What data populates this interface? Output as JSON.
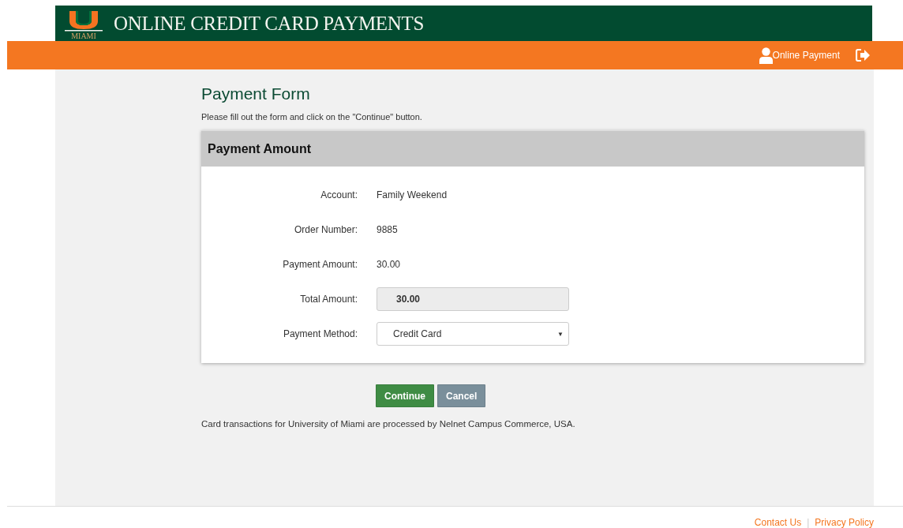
{
  "header": {
    "logo_text": "MIAMI",
    "title": "ONLINE CREDIT CARD PAYMENTS"
  },
  "nav": {
    "user_label": "Online Payment"
  },
  "page": {
    "title": "Payment Form",
    "instructions": "Please fill out the form and click on the \"Continue\" button."
  },
  "panel": {
    "title": "Payment Amount",
    "rows": [
      {
        "kind": "text",
        "label": "Account:",
        "value": "Family Weekend"
      },
      {
        "kind": "text",
        "label": "Order Number:",
        "value": "9885"
      },
      {
        "kind": "text",
        "label": "Payment Amount:",
        "value": "30.00"
      },
      {
        "kind": "readonly",
        "label": "Total Amount:",
        "value": "30.00"
      },
      {
        "kind": "select",
        "label": "Payment Method:",
        "value": "Credit Card",
        "caret": "▼"
      }
    ]
  },
  "buttons": [
    {
      "kind": "primary",
      "label": "Continue"
    },
    {
      "kind": "secondary",
      "label": "Cancel"
    }
  ],
  "notice": "Card transactions for University of Miami are processed by Nelnet Campus Commerce, USA.",
  "footer": {
    "links": [
      "Contact Us",
      "Privacy Policy"
    ],
    "separator": "|"
  }
}
